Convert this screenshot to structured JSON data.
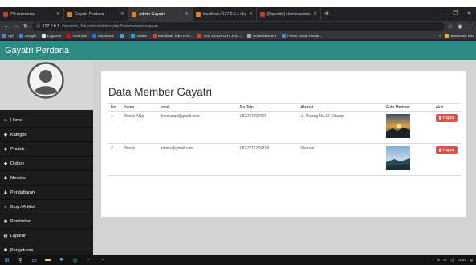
{
  "browser": {
    "tabs": [
      {
        "label": "PB Indonesia",
        "color": "#c0392b"
      },
      {
        "label": "Gayatri Perdana",
        "color": "#e67e22"
      },
      {
        "label": "Admin Gayatri",
        "color": "#e67e22",
        "active": true
      },
      {
        "label": "localhost / 127.0.0.1 / tu / peri",
        "color": "#e67e22"
      },
      {
        "label": "[Expertiis] Nomor autoriasi yu",
        "color": "#c0392b"
      }
    ],
    "url_host": "127.0.0.1",
    "url_path": "/lbernilah_Toko/admin/index.php?halaman=pelanggan",
    "bookmarks": [
      {
        "label": "Apl",
        "color": "#4285f4"
      },
      {
        "label": "Google",
        "color": "#4285f4"
      },
      {
        "label": "Logmein",
        "color": "#e8e8e8"
      },
      {
        "label": "YouTube",
        "color": "#ff0000"
      },
      {
        "label": "Facebook",
        "color": "#1877f2"
      },
      {
        "label": "",
        "color": "#3aa9f5"
      },
      {
        "label": "Twitter",
        "color": "#1da1f2"
      },
      {
        "label": "Membuat Toko Onli...",
        "color": "#e53935"
      },
      {
        "label": "TAS JANSPORT JOG...",
        "color": "#e53935"
      },
      {
        "label": "Advertisement",
        "color": "#aaaaaa"
      },
      {
        "label": "Fitnes Untuk Pemul...",
        "color": "#4285f4"
      }
    ],
    "bookmarks_other": "Bookmark lain"
  },
  "app": {
    "brand": "Gayatri Perdana",
    "menu": [
      {
        "label": "Home",
        "icon": "home-icon",
        "glyph": "⌂"
      },
      {
        "label": "Kategori",
        "icon": "tag-icon",
        "glyph": "◆"
      },
      {
        "label": "Produk",
        "icon": "tag-icon",
        "glyph": "◆"
      },
      {
        "label": "Diskon",
        "icon": "tag-icon",
        "glyph": "◆"
      },
      {
        "label": "Member",
        "icon": "user-icon",
        "glyph": "♟"
      },
      {
        "label": "Pendaftaran",
        "icon": "user-icon",
        "glyph": "♟"
      },
      {
        "label": "Blog / Artikel",
        "icon": "list-icon",
        "glyph": "≡"
      },
      {
        "label": "Pembelian",
        "icon": "globe-icon",
        "glyph": "◉"
      },
      {
        "label": "Laporan",
        "icon": "print-icon",
        "glyph": "▤"
      },
      {
        "label": "Pengaturan",
        "icon": "gear-icon",
        "glyph": "✱"
      }
    ]
  },
  "main": {
    "title": "Data Member Gayatri",
    "columns": [
      "No",
      "Nama",
      "email",
      "No Telp",
      "Alamat",
      "Foto Member",
      "Aksi"
    ],
    "rows": [
      {
        "no": "1",
        "nama": "Jhenis ANp",
        "email": "jhenisanp@gmail.com",
        "telp": "082227597626",
        "alamat": "JL Pisang No.16 Cilacap",
        "aksi": "Hapus"
      },
      {
        "no": "2",
        "nama": "Jhenis",
        "email": "admin@gmail.com",
        "telp": "0822276282828",
        "alamat": "Sleman",
        "aksi": "Hapus"
      }
    ]
  },
  "taskbar": {
    "time": "14:02"
  }
}
